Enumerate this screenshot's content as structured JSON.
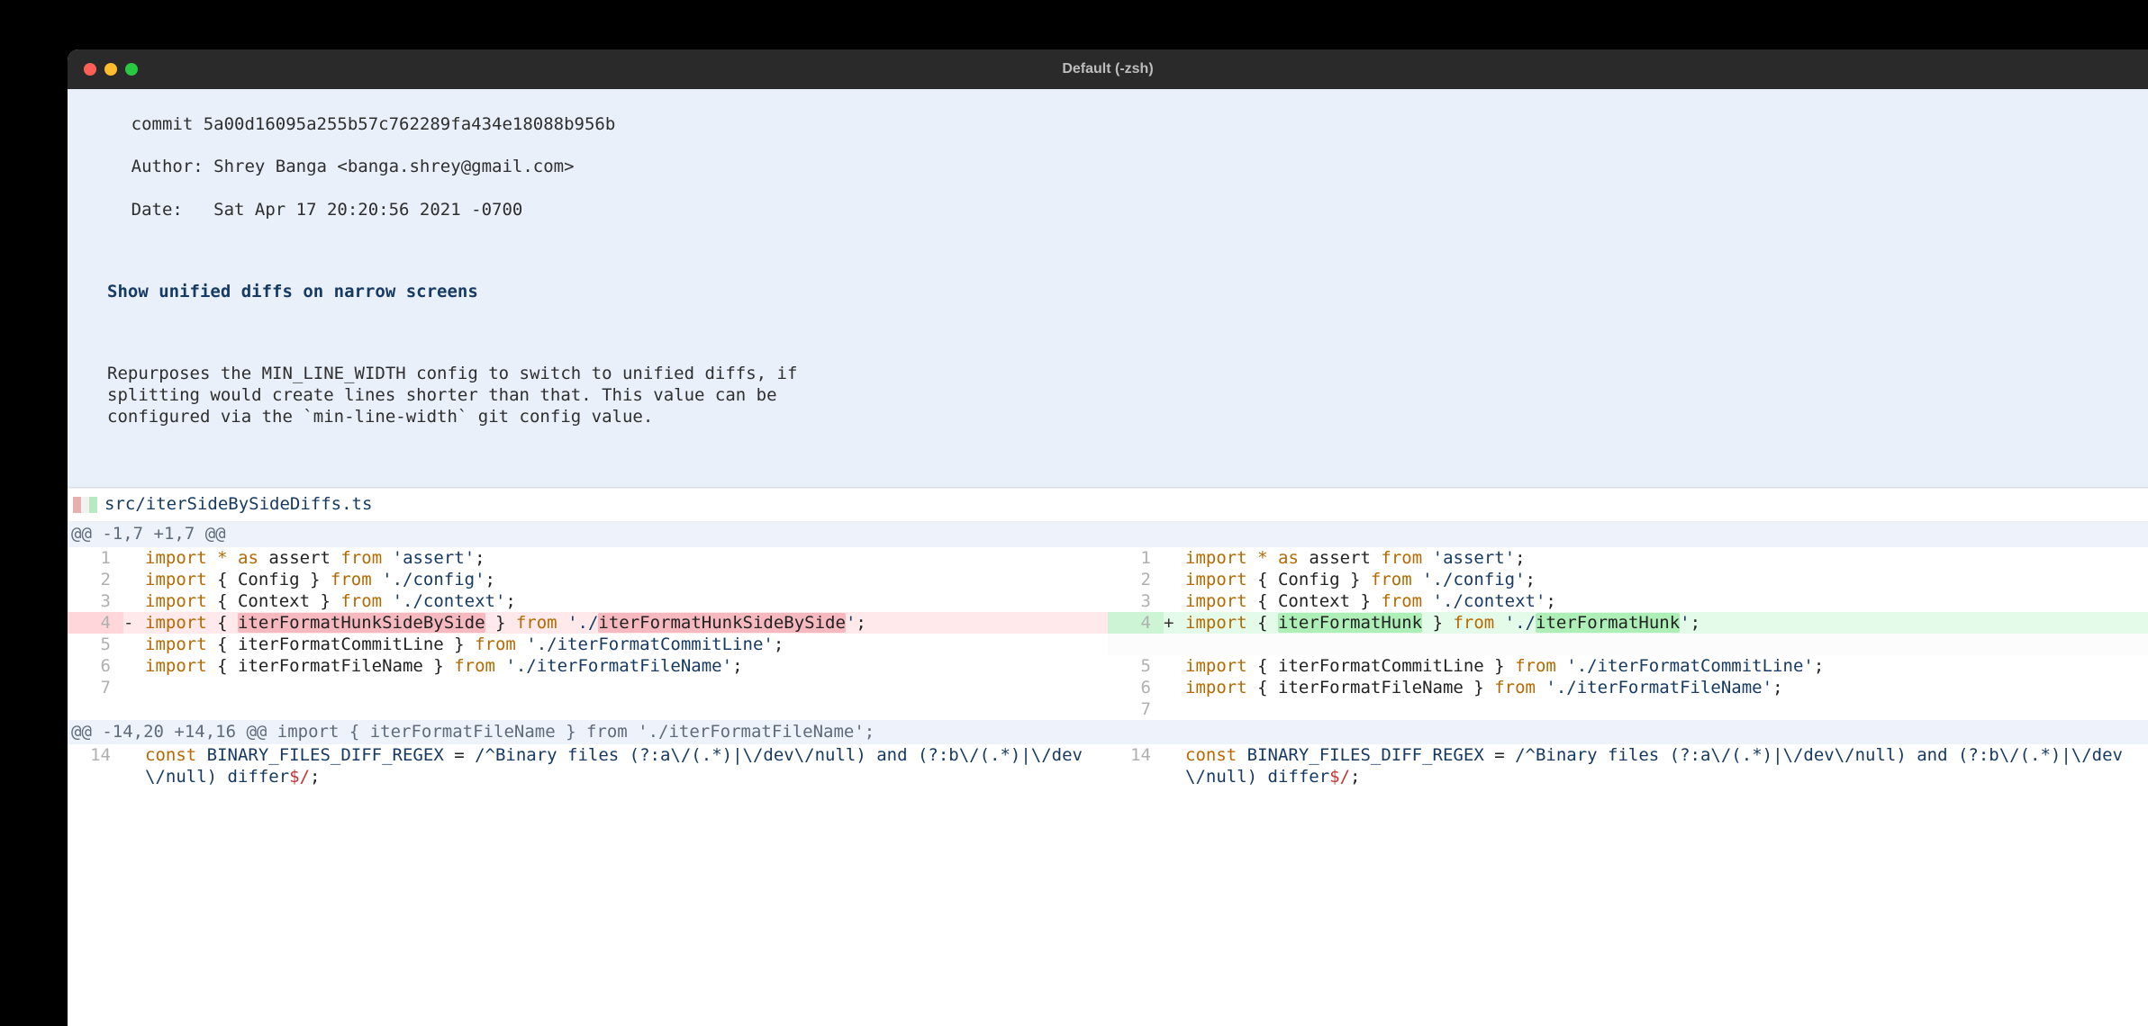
{
  "window": {
    "title": "Default (-zsh)"
  },
  "commit": {
    "sha_line": "commit 5a00d16095a255b57c762289fa434e18088b956b",
    "author_line": "Author: Shrey Banga <banga.shrey@gmail.com>",
    "date_line": "Date:   Sat Apr 17 20:20:56 2021 -0700",
    "title": "Show unified diffs on narrow screens",
    "body": "Repurposes the MIN_LINE_WIDTH config to switch to unified diffs, if\nsplitting would create lines shorter than that. This value can be\nconfigured via the `min-line-width` git config value."
  },
  "file": {
    "path": "src/iterSideBySideDiffs.ts"
  },
  "hunks": [
    {
      "header": "@@ -1,7 +1,7 @@",
      "ctx": "",
      "left": [
        {
          "n": "1",
          "sign": "",
          "type": "ctx",
          "tokens": [
            [
              "k-import",
              "import"
            ],
            [
              "k-punc",
              " "
            ],
            [
              "k-star",
              "*"
            ],
            [
              "k-punc",
              " "
            ],
            [
              "k-import",
              "as"
            ],
            [
              "k-punc",
              " assert "
            ],
            [
              "k-import",
              "from"
            ],
            [
              "k-punc",
              " "
            ],
            [
              "k-str",
              "'assert'"
            ],
            [
              "k-punc",
              ";"
            ]
          ]
        },
        {
          "n": "2",
          "sign": "",
          "type": "ctx",
          "tokens": [
            [
              "k-import",
              "import"
            ],
            [
              "k-punc",
              " { Config } "
            ],
            [
              "k-import",
              "from"
            ],
            [
              "k-punc",
              " "
            ],
            [
              "k-str",
              "'./config'"
            ],
            [
              "k-punc",
              ";"
            ]
          ]
        },
        {
          "n": "3",
          "sign": "",
          "type": "ctx",
          "tokens": [
            [
              "k-import",
              "import"
            ],
            [
              "k-punc",
              " { Context } "
            ],
            [
              "k-import",
              "from"
            ],
            [
              "k-punc",
              " "
            ],
            [
              "k-str",
              "'./context'"
            ],
            [
              "k-punc",
              ";"
            ]
          ]
        },
        {
          "n": "4",
          "sign": "-",
          "type": "del",
          "tokens": [
            [
              "k-import",
              "import"
            ],
            [
              "k-punc",
              " { "
            ],
            [
              "hl-del",
              "iterFormatHunkSideBySide"
            ],
            [
              "k-punc",
              " } "
            ],
            [
              "k-import",
              "from"
            ],
            [
              "k-punc",
              " "
            ],
            [
              "k-str",
              "'./"
            ],
            [
              "hl-del",
              "iterFormatHunkSideBySide"
            ],
            [
              "k-str",
              "'"
            ],
            [
              "k-punc",
              ";"
            ]
          ],
          "wrap": true
        },
        {
          "n": "5",
          "sign": "",
          "type": "ctx",
          "tokens": [
            [
              "k-import",
              "import"
            ],
            [
              "k-punc",
              " { iterFormatCommitLine } "
            ],
            [
              "k-import",
              "from"
            ],
            [
              "k-punc",
              " "
            ],
            [
              "k-str",
              "'./iterFormatCommitLine'"
            ],
            [
              "k-punc",
              ";"
            ]
          ],
          "wrap": true
        },
        {
          "n": "6",
          "sign": "",
          "type": "ctx",
          "tokens": [
            [
              "k-import",
              "import"
            ],
            [
              "k-punc",
              " { iterFormatFileName } "
            ],
            [
              "k-import",
              "from"
            ],
            [
              "k-punc",
              " "
            ],
            [
              "k-str",
              "'./iterFormatFileName'"
            ],
            [
              "k-punc",
              ";"
            ]
          ]
        },
        {
          "n": "7",
          "sign": "",
          "type": "ctx",
          "tokens": []
        }
      ],
      "right": [
        {
          "n": "1",
          "sign": "",
          "type": "ctx",
          "tokens": [
            [
              "k-import",
              "import"
            ],
            [
              "k-punc",
              " "
            ],
            [
              "k-star",
              "*"
            ],
            [
              "k-punc",
              " "
            ],
            [
              "k-import",
              "as"
            ],
            [
              "k-punc",
              " assert "
            ],
            [
              "k-import",
              "from"
            ],
            [
              "k-punc",
              " "
            ],
            [
              "k-str",
              "'assert'"
            ],
            [
              "k-punc",
              ";"
            ]
          ]
        },
        {
          "n": "2",
          "sign": "",
          "type": "ctx",
          "tokens": [
            [
              "k-import",
              "import"
            ],
            [
              "k-punc",
              " { Config } "
            ],
            [
              "k-import",
              "from"
            ],
            [
              "k-punc",
              " "
            ],
            [
              "k-str",
              "'./config'"
            ],
            [
              "k-punc",
              ";"
            ]
          ]
        },
        {
          "n": "3",
          "sign": "",
          "type": "ctx",
          "tokens": [
            [
              "k-import",
              "import"
            ],
            [
              "k-punc",
              " { Context } "
            ],
            [
              "k-import",
              "from"
            ],
            [
              "k-punc",
              " "
            ],
            [
              "k-str",
              "'./context'"
            ],
            [
              "k-punc",
              ";"
            ]
          ]
        },
        {
          "n": "4",
          "sign": "+",
          "type": "add",
          "tokens": [
            [
              "k-import",
              "import"
            ],
            [
              "k-punc",
              " { "
            ],
            [
              "hl-add",
              "iterFormatHunk"
            ],
            [
              "k-punc",
              " } "
            ],
            [
              "k-import",
              "from"
            ],
            [
              "k-punc",
              " "
            ],
            [
              "k-str",
              "'./"
            ],
            [
              "hl-add",
              "iterFormatHunk"
            ],
            [
              "k-str",
              "'"
            ],
            [
              "k-punc",
              ";"
            ]
          ]
        },
        {
          "n": "",
          "sign": "",
          "type": "empty",
          "tokens": []
        },
        {
          "n": "5",
          "sign": "",
          "type": "ctx",
          "tokens": [
            [
              "k-import",
              "import"
            ],
            [
              "k-punc",
              " { iterFormatCommitLine } "
            ],
            [
              "k-import",
              "from"
            ],
            [
              "k-punc",
              " "
            ],
            [
              "k-str",
              "'./iterFormatCommitLine'"
            ],
            [
              "k-punc",
              ";"
            ]
          ],
          "wrap": true
        },
        {
          "n": "6",
          "sign": "",
          "type": "ctx",
          "tokens": [
            [
              "k-import",
              "import"
            ],
            [
              "k-punc",
              " { iterFormatFileName } "
            ],
            [
              "k-import",
              "from"
            ],
            [
              "k-punc",
              " "
            ],
            [
              "k-str",
              "'./iterFormatFileName'"
            ],
            [
              "k-punc",
              ";"
            ]
          ]
        },
        {
          "n": "7",
          "sign": "",
          "type": "ctx",
          "tokens": []
        }
      ]
    },
    {
      "header": "@@ -14,20 +14,16 @@",
      "ctx": " import { iterFormatFileName } from './iterFormatFileName';",
      "left": [
        {
          "n": "14",
          "sign": "",
          "type": "ctx",
          "tokens": [
            [
              "k-const",
              "const"
            ],
            [
              "k-punc",
              " "
            ],
            [
              "k-ident",
              "BINARY_FILES_DIFF_REGEX"
            ],
            [
              "k-punc",
              " = "
            ],
            [
              "k-regex",
              "/^Binary files (?:a\\/(.*)|\\/dev\\/null) and (?:b\\/(.*)|\\/dev\\/null) differ"
            ],
            [
              "k-regex-end",
              "$/"
            ],
            [
              "k-punc",
              ";"
            ]
          ]
        }
      ],
      "right": [
        {
          "n": "14",
          "sign": "",
          "type": "ctx",
          "tokens": [
            [
              "k-const",
              "const"
            ],
            [
              "k-punc",
              " "
            ],
            [
              "k-ident",
              "BINARY_FILES_DIFF_REGEX"
            ],
            [
              "k-punc",
              " = "
            ],
            [
              "k-regex",
              "/^Binary files (?:a\\/(.*)|\\/dev\\/null) and (?:b\\/(.*)|\\/dev\\/null) differ"
            ],
            [
              "k-regex-end",
              "$/"
            ],
            [
              "k-punc",
              ";"
            ]
          ]
        }
      ]
    }
  ]
}
